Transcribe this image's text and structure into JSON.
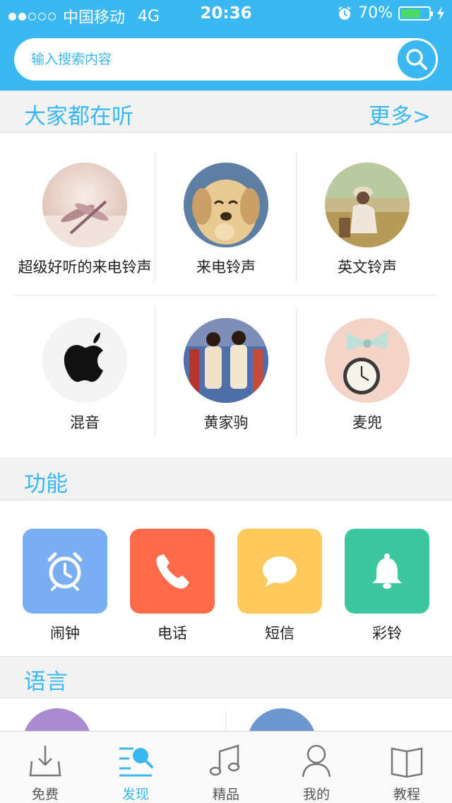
{
  "status_bar": {
    "carrier": "中国移动",
    "network": "4G",
    "time": "20:36",
    "battery_percent": "70%",
    "battery_level": 0.7,
    "signal_bars": 2
  },
  "search": {
    "placeholder": "输入搜索内容",
    "button_icon": "search-icon"
  },
  "listening": {
    "title": "大家都在听",
    "more": "更多>",
    "items": [
      {
        "label": "超级好听的来电铃声",
        "image": "dragonfly-photo"
      },
      {
        "label": "来电铃声",
        "image": "puppy-photo"
      },
      {
        "label": "英文铃声",
        "image": "girl-in-field-photo"
      },
      {
        "label": "混音",
        "image": "apple-logo"
      },
      {
        "label": "黄家驹",
        "image": "band-photo"
      },
      {
        "label": "麦兜",
        "image": "pocket-watch-photo"
      }
    ]
  },
  "functions": {
    "title": "功能",
    "items": [
      {
        "label": "闹钟",
        "icon": "alarm-clock-icon",
        "color": "#7aaef2"
      },
      {
        "label": "电话",
        "icon": "phone-icon",
        "color": "#ff6a4a"
      },
      {
        "label": "短信",
        "icon": "message-bubble-icon",
        "color": "#ffc95c"
      },
      {
        "label": "彩铃",
        "icon": "bell-icon",
        "color": "#3cc79e"
      }
    ]
  },
  "language": {
    "title": "语言"
  },
  "tabbar": {
    "items": [
      {
        "label": "免费",
        "icon": "download-tray-icon",
        "active": false
      },
      {
        "label": "发现",
        "icon": "discover-search-icon",
        "active": true
      },
      {
        "label": "精品",
        "icon": "music-note-icon",
        "active": false
      },
      {
        "label": "我的",
        "icon": "user-icon",
        "active": false
      },
      {
        "label": "教程",
        "icon": "book-icon",
        "active": false
      }
    ]
  },
  "colors": {
    "accent": "#3bb7f2",
    "battery": "#4cd964"
  }
}
